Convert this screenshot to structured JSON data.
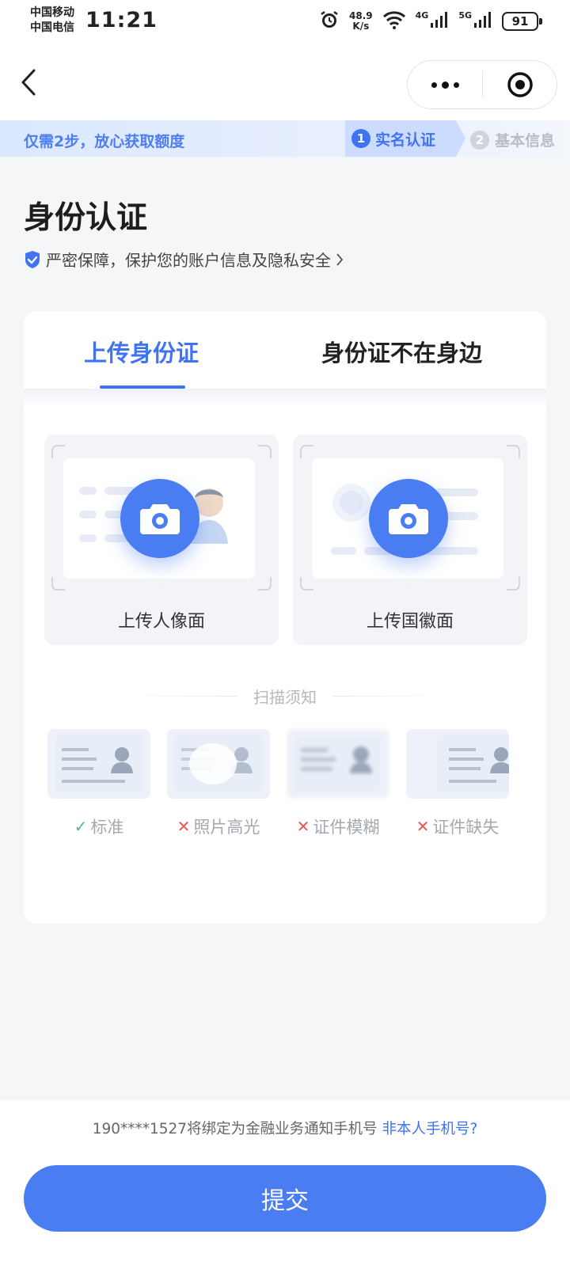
{
  "status_bar": {
    "carrier_1": "中国移动",
    "carrier_2": "中国电信",
    "time": "11:21",
    "net_speed_value": "48.9",
    "net_speed_unit": "K/s",
    "sim1_type": "4G",
    "sim2_type": "5G",
    "battery": "91"
  },
  "steps": {
    "slogan": "仅需2步，放心获取额度",
    "items": [
      {
        "num": "1",
        "label": "实名认证"
      },
      {
        "num": "2",
        "label": "基本信息"
      }
    ]
  },
  "heading": {
    "title": "身份认证",
    "security_note": "严密保障，保护您的账户信息及隐私安全"
  },
  "tabs": [
    {
      "label": "上传身份证"
    },
    {
      "label": "身份证不在身边"
    }
  ],
  "upload": {
    "front_label": "上传人像面",
    "back_label": "上传国徽面"
  },
  "scan_tips": {
    "title": "扫描须知",
    "items": [
      {
        "label": "标准",
        "ok": true
      },
      {
        "label": "照片高光",
        "ok": false
      },
      {
        "label": "证件模糊",
        "ok": false
      },
      {
        "label": "证件缺失",
        "ok": false
      }
    ]
  },
  "footer": {
    "bind_note": "190****1527将绑定为金融业务通知手机号",
    "not_mine_link": "非本人手机号?",
    "submit_label": "提交"
  },
  "colors": {
    "accent": "#3f73f2",
    "button": "#4a7cf2",
    "ok": "#4cb982",
    "error": "#ea5656"
  }
}
